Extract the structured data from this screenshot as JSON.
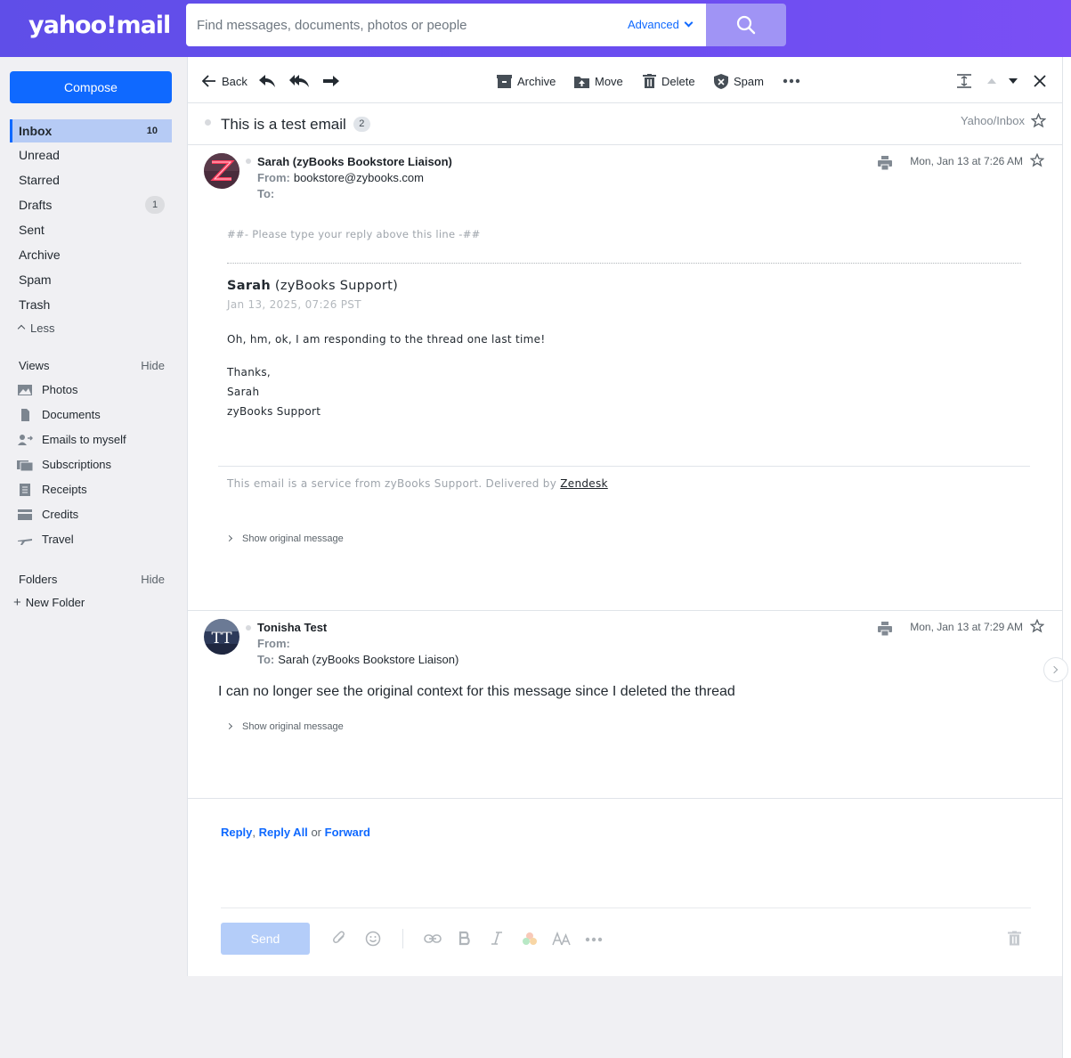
{
  "header": {
    "logo_text": "yahoo!mail",
    "search_placeholder": "Find messages, documents, photos or people",
    "advanced_label": "Advanced",
    "search_icon": "search-icon"
  },
  "sidebar": {
    "compose_label": "Compose",
    "items": [
      {
        "label": "Inbox",
        "count": "10"
      },
      {
        "label": "Unread"
      },
      {
        "label": "Starred"
      },
      {
        "label": "Drafts",
        "count": "1"
      },
      {
        "label": "Sent"
      },
      {
        "label": "Archive"
      },
      {
        "label": "Spam"
      },
      {
        "label": "Trash"
      }
    ],
    "less_label": "Less",
    "views_title": "Views",
    "views_hide": "Hide",
    "views": [
      {
        "label": "Photos",
        "icon": "photos-icon"
      },
      {
        "label": "Documents",
        "icon": "documents-icon"
      },
      {
        "label": "Emails to myself",
        "icon": "emails-to-myself-icon"
      },
      {
        "label": "Subscriptions",
        "icon": "subscriptions-icon"
      },
      {
        "label": "Receipts",
        "icon": "receipts-icon"
      },
      {
        "label": "Credits",
        "icon": "credits-icon"
      },
      {
        "label": "Travel",
        "icon": "travel-icon"
      }
    ],
    "folders_title": "Folders",
    "folders_hide": "Hide",
    "new_folder_label": "New Folder"
  },
  "toolbar": {
    "back_label": "Back",
    "archive_label": "Archive",
    "move_label": "Move",
    "delete_label": "Delete",
    "spam_label": "Spam"
  },
  "thread": {
    "subject": "This is a test email",
    "count": "2",
    "folder_path": "Yahoo/Inbox"
  },
  "messages": [
    {
      "sender": "Sarah (zyBooks Bookstore Liaison)",
      "from_label": "From:",
      "from": "bookstore@zybooks.com",
      "to_label": "To:",
      "to": "",
      "date": "Mon, Jan 13 at 7:26 AM",
      "reply_line": "##- Please type your reply above this line -##",
      "agent_name": "Sarah",
      "agent_team": "(zyBooks Support)",
      "agent_date": "Jan 13, 2025, 07:26 PST",
      "body_lines": [
        "Oh, hm, ok, I am responding to the thread one last time!",
        "Thanks,",
        "Sarah",
        "zyBooks Support"
      ],
      "footer_text": "This email is a service from zyBooks Support. Delivered by",
      "footer_link": "Zendesk",
      "show_original": "Show original message"
    },
    {
      "sender": "Tonisha Test",
      "from_label": "From:",
      "from": "",
      "to_label": "To:",
      "to": "Sarah (zyBooks Bookstore Liaison)",
      "date": "Mon, Jan 13 at 7:29 AM",
      "body": "I can no longer see the original context for this message since I deleted the thread",
      "show_original": "Show original message",
      "avatar_initials": "TT"
    }
  ],
  "reply_bar": {
    "reply": "Reply",
    "comma": ",",
    "reply_all": "Reply All",
    "or": "or",
    "forward": "Forward",
    "send_label": "Send"
  },
  "colors": {
    "brand": "#6a4df0",
    "accent": "#0f69ff"
  }
}
